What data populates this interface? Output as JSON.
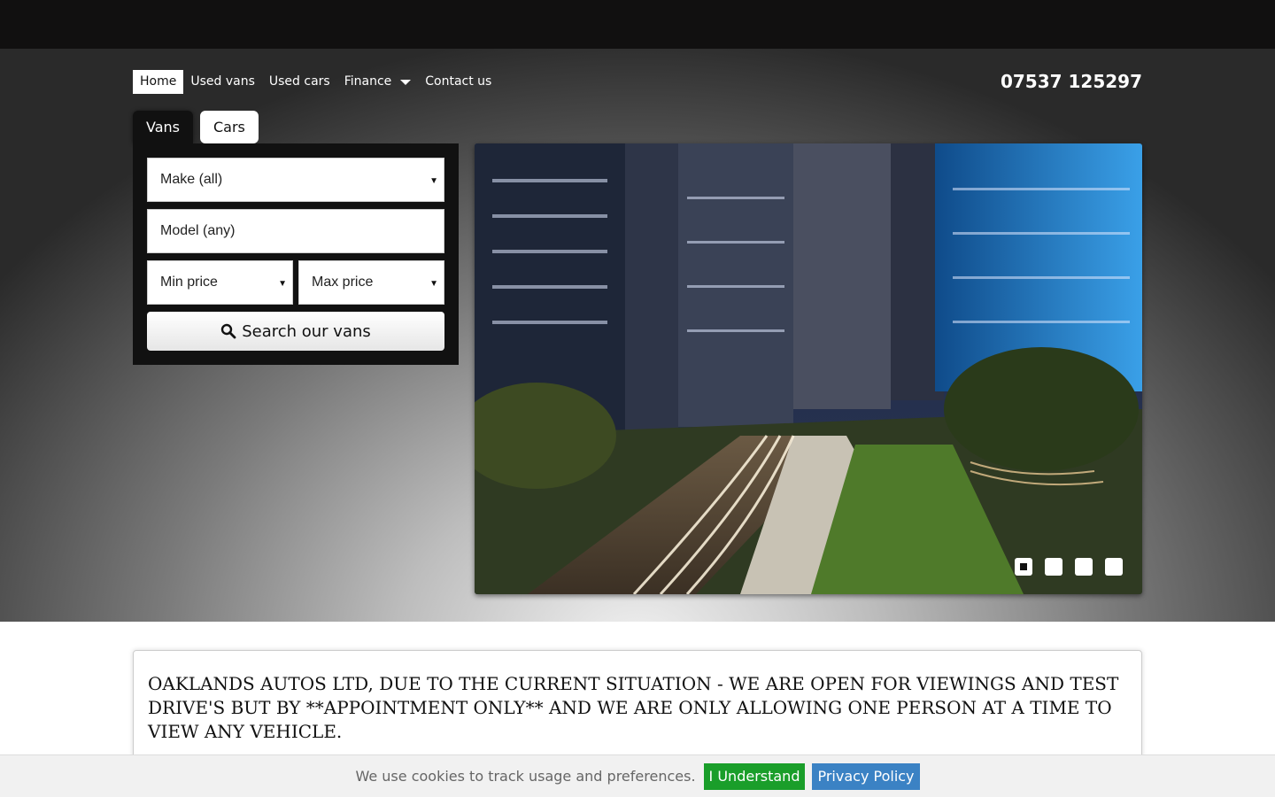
{
  "nav": {
    "items": [
      {
        "label": "Home",
        "active": true
      },
      {
        "label": "Used vans"
      },
      {
        "label": "Used cars"
      },
      {
        "label": "Finance",
        "has_dropdown": true
      },
      {
        "label": "Contact us"
      }
    ],
    "phone": "07537 125297"
  },
  "search": {
    "tabs": [
      {
        "label": "Vans",
        "active": true
      },
      {
        "label": "Cars"
      }
    ],
    "make": "Make (all)",
    "model": "Model (any)",
    "min_price": "Min price",
    "max_price": "Max price",
    "button_label": "Search our vans"
  },
  "slider": {
    "slide_count": 4,
    "active_index": 0
  },
  "notice": {
    "text": "OAKLANDS AUTOS LTD, DUE TO THE CURRENT SITUATION - WE ARE OPEN FOR VIEWINGS AND TEST DRIVE'S BUT BY **APPOINTMENT ONLY** AND WE ARE ONLY ALLOWING ONE PERSON AT A TIME TO VIEW ANY VEHICLE."
  },
  "cookie": {
    "text": "We use cookies to track usage and preferences.",
    "accept_label": "I Understand",
    "privacy_label": "Privacy Policy"
  },
  "colors": {
    "accept": "#1a9e2a",
    "privacy": "#3b82c4",
    "panel": "#111111"
  }
}
